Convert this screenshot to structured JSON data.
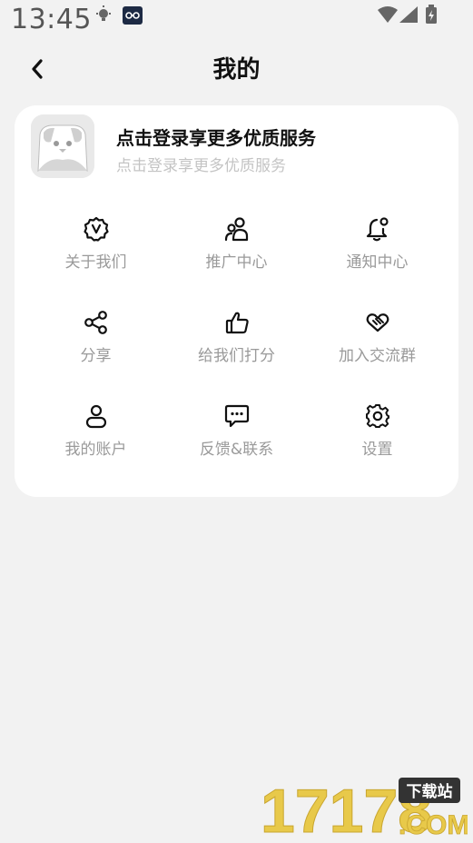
{
  "status_bar": {
    "time": "13:45"
  },
  "header": {
    "title": "我的"
  },
  "login_card": {
    "title": "点击登录享更多优质服务",
    "subtitle": "点击登录享更多优质服务"
  },
  "menu": [
    {
      "label": "关于我们",
      "icon": "badge-v-icon"
    },
    {
      "label": "推广中心",
      "icon": "users-icon"
    },
    {
      "label": "通知中心",
      "icon": "bell-icon"
    },
    {
      "label": "分享",
      "icon": "share-icon"
    },
    {
      "label": "给我们打分",
      "icon": "thumbs-up-icon"
    },
    {
      "label": "加入交流群",
      "icon": "handshake-icon"
    },
    {
      "label": "我的账户",
      "icon": "user-icon"
    },
    {
      "label": "反馈&联系",
      "icon": "chat-icon"
    },
    {
      "label": "设置",
      "icon": "gear-icon"
    }
  ],
  "watermark": {
    "text": "17178",
    "badge": "下载站",
    "domain": ".COM"
  },
  "colors": {
    "background": "#f2f2f2",
    "card": "#ffffff",
    "label": "#9a9a9a",
    "watermark": "#e8c94a"
  }
}
